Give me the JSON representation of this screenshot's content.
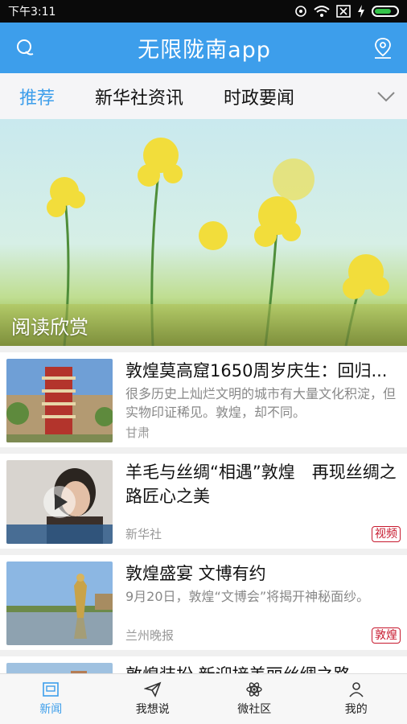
{
  "status": {
    "time": "下午3:11"
  },
  "header": {
    "title": "无限陇南app"
  },
  "tabs": [
    {
      "label": "推荐"
    },
    {
      "label": "新华社资讯"
    },
    {
      "label": "时政要闻"
    }
  ],
  "banner": {
    "caption": "阅读欣赏"
  },
  "articles": [
    {
      "title": "敦煌莫高窟1650周岁庆生：回归...",
      "summary": "很多历史上灿烂文明的城市有大量文化积淀，但实物印证稀见。敦煌，却不同。",
      "source": "甘肃",
      "tag": ""
    },
    {
      "title": "羊毛与丝绸“相遇”敦煌　再现丝绸之路匠心之美",
      "summary": "",
      "source": "新华社",
      "tag": "视频"
    },
    {
      "title": "敦煌盛宴 文博有约",
      "summary": "9月20日，敦煌“文博会”将揭开神秘面纱。",
      "source": "兰州晚报",
      "tag": "敦煌"
    },
    {
      "title": "敦煌装扮 新迎接美丽丝绸之路",
      "summary": "",
      "source": "",
      "tag": ""
    }
  ],
  "bottom_nav": [
    {
      "label": "新闻"
    },
    {
      "label": "我想说"
    },
    {
      "label": "微社区"
    },
    {
      "label": "我的"
    }
  ],
  "colors": {
    "accent": "#3d9eeb",
    "tag": "#c7192e"
  }
}
